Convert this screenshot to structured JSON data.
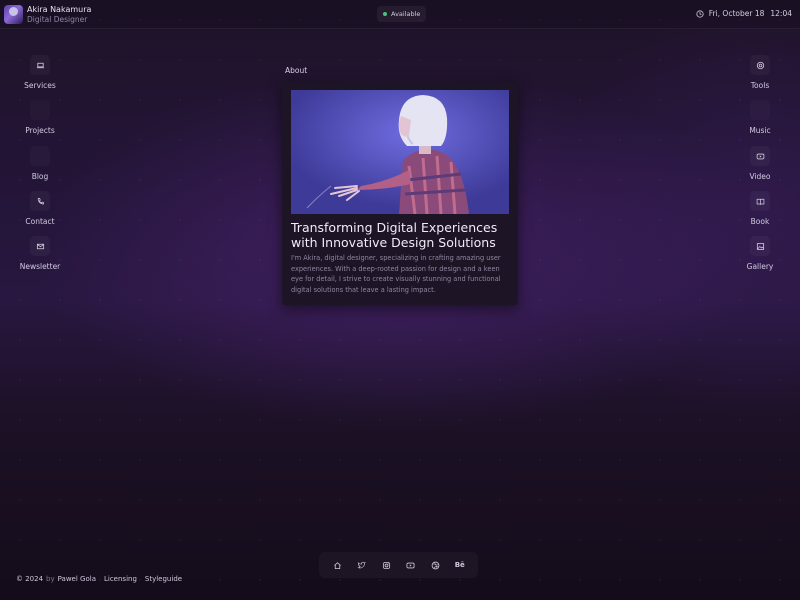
{
  "header": {
    "name": "Akira Nakamura",
    "role": "Digital Designer",
    "status": "Available",
    "date": "Fri, October 18",
    "time": "12:04"
  },
  "left_apps": [
    {
      "label": "Services",
      "icon": "laptop-icon"
    },
    {
      "label": "Projects",
      "icon": ""
    },
    {
      "label": "Blog",
      "icon": ""
    },
    {
      "label": "Contact",
      "icon": "phone-icon"
    },
    {
      "label": "Newsletter",
      "icon": "mail-icon"
    }
  ],
  "right_apps": [
    {
      "label": "Tools",
      "icon": "tools-icon"
    },
    {
      "label": "Music",
      "icon": ""
    },
    {
      "label": "Video",
      "icon": "video-icon"
    },
    {
      "label": "Book",
      "icon": "book-icon"
    },
    {
      "label": "Gallery",
      "icon": "image-icon"
    }
  ],
  "about": {
    "window_title": "About",
    "headline": "Transforming Digital Experiences with Innovative Design Solutions",
    "body": "I'm Akira, digital designer, specializing in crafting amazing user experiences. With a deep-rooted passion for design and a keen eye for detail, I strive to create visually stunning and functional digital solutions that leave a lasting impact."
  },
  "dock": [
    {
      "name": "home-icon"
    },
    {
      "name": "twitter-icon"
    },
    {
      "name": "instagram-icon"
    },
    {
      "name": "youtube-icon"
    },
    {
      "name": "dribbble-icon"
    },
    {
      "name": "behance-icon",
      "text": "Bē"
    }
  ],
  "footer": {
    "copyright": "© 2024",
    "by": "by",
    "author": "Pawel Gola",
    "licensing": "Licensing",
    "styleguide": "Styleguide"
  },
  "colors": {
    "background": "#1e1328",
    "card": "#1d1425",
    "status_dot": "#4ec07a",
    "hero": "#4a47b0"
  }
}
